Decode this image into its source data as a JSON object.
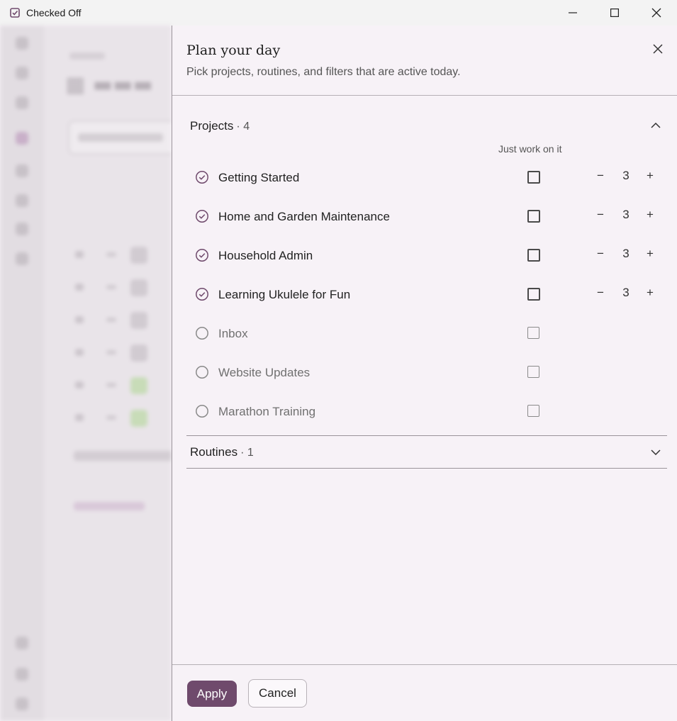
{
  "window": {
    "title": "Checked Off",
    "icon": "checkbox-icon",
    "controls": [
      "minimize-icon",
      "maximize-icon",
      "close-icon"
    ]
  },
  "dialog": {
    "title": "Plan your day",
    "subtitle": "Pick projects, routines, and filters that are active today.",
    "column_label": "Just work on it",
    "projects_section": {
      "label": "Projects",
      "count": "· 4",
      "expanded": true
    },
    "projects": [
      {
        "name": "Getting Started",
        "active": true,
        "just_work": false,
        "count": "3"
      },
      {
        "name": "Home and Garden Maintenance",
        "active": true,
        "just_work": false,
        "count": "3"
      },
      {
        "name": "Household Admin",
        "active": true,
        "just_work": false,
        "count": "3"
      },
      {
        "name": "Learning Ukulele for Fun",
        "active": true,
        "just_work": false,
        "count": "3"
      },
      {
        "name": "Inbox",
        "active": false,
        "just_work": false
      },
      {
        "name": "Website Updates",
        "active": false,
        "just_work": false
      },
      {
        "name": "Marathon Training",
        "active": false,
        "just_work": false
      }
    ],
    "routines_section": {
      "label": "Routines",
      "count": "· 1",
      "expanded": false
    },
    "stepper": {
      "minus": "−",
      "plus": "+"
    },
    "apply_label": "Apply",
    "cancel_label": "Cancel"
  },
  "colors": {
    "accent": "#6f4a6c",
    "background": "#f7f2f7"
  }
}
